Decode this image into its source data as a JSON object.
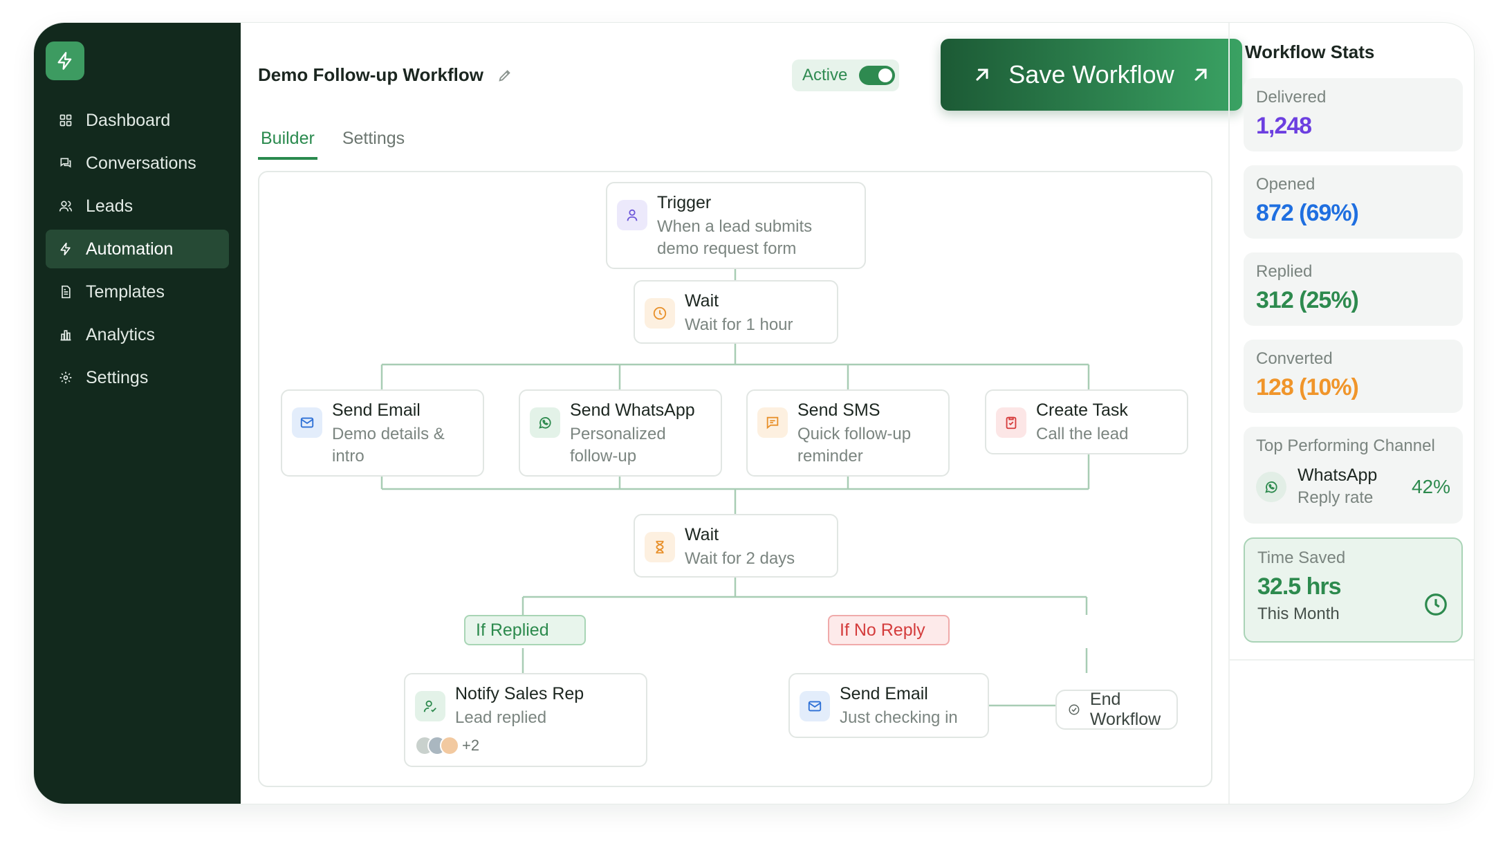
{
  "sidebar": {
    "items": [
      {
        "label": "Dashboard",
        "icon": "grid-icon"
      },
      {
        "label": "Conversations",
        "icon": "chat-icon"
      },
      {
        "label": "Leads",
        "icon": "users-icon"
      },
      {
        "label": "Automation",
        "icon": "bolt-icon",
        "active": true
      },
      {
        "label": "Templates",
        "icon": "document-icon"
      },
      {
        "label": "Analytics",
        "icon": "bar-chart-icon"
      },
      {
        "label": "Settings",
        "icon": "gear-icon"
      }
    ]
  },
  "header": {
    "title": "Demo Follow-up Workflow",
    "status_label": "Active",
    "status_on": true,
    "save_label": "Save Workflow"
  },
  "tabs": [
    {
      "label": "Builder",
      "active": true
    },
    {
      "label": "Settings",
      "active": false
    }
  ],
  "workflow": {
    "trigger": {
      "title": "Trigger",
      "sub1": "When a lead submits",
      "sub2": "demo request form"
    },
    "wait1": {
      "title": "Wait",
      "sub": "Wait for 1 hour"
    },
    "actions": [
      {
        "title": "Send Email",
        "sub1": "Demo details &",
        "sub2": "intro"
      },
      {
        "title": "Send WhatsApp",
        "sub1": "Personalized",
        "sub2": "follow-up"
      },
      {
        "title": "Send SMS",
        "sub1": "Quick follow-up",
        "sub2": "reminder"
      },
      {
        "title": "Create Task",
        "sub1": "Call the lead",
        "sub2": ""
      }
    ],
    "wait2": {
      "title": "Wait",
      "sub": "Wait for 2 days"
    },
    "branch_yes": "If Replied",
    "branch_no": "If No Reply",
    "notify": {
      "title": "Notify Sales Rep",
      "sub": "Lead replied",
      "more": "+2"
    },
    "followup": {
      "title": "Send Email",
      "sub": "Just checking in"
    },
    "end": "End Workflow"
  },
  "stats": {
    "title": "Workflow Stats",
    "delivered": {
      "label": "Delivered",
      "value": "1,248"
    },
    "opened": {
      "label": "Opened",
      "value": "872 (69%)"
    },
    "replied": {
      "label": "Replied",
      "value": "312 (25%)"
    },
    "converted": {
      "label": "Converted",
      "value": "128 (10%)"
    },
    "top_channel": {
      "label": "Top Performing Channel",
      "name": "WhatsApp",
      "sub": "Reply rate",
      "pct": "42%"
    },
    "time_saved": {
      "label": "Time Saved",
      "value": "32.5 hrs",
      "sub": "This Month"
    }
  },
  "colors": {
    "sidebar_bg": "#12291d",
    "accent_green": "#2d8a4e",
    "delivered": "#6c3fe0",
    "opened": "#1f6fe0",
    "replied": "#2d8a4e",
    "converted": "#f0952a"
  }
}
